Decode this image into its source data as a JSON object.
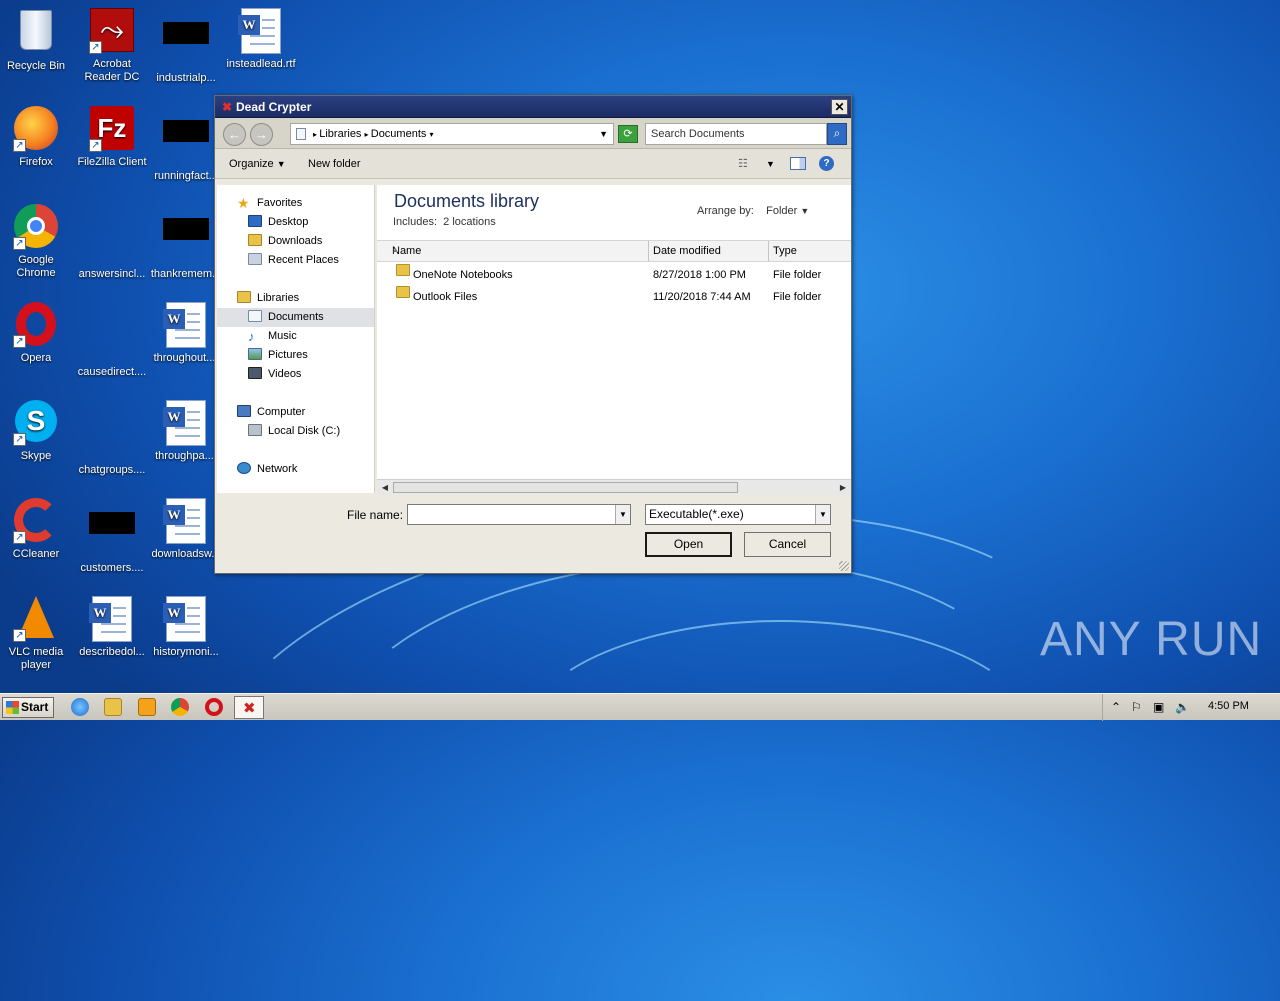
{
  "desktop": {
    "icons": [
      {
        "label": "Recycle Bin",
        "icon": "recycle-bin-icon"
      },
      {
        "label": "Acrobat Reader DC",
        "icon": "acrobat-icon"
      },
      {
        "label": "industrialp...",
        "icon": "redacted-icon"
      },
      {
        "label": "insteadlead.rtf",
        "icon": "word-doc-icon"
      },
      {
        "label": "Firefox",
        "icon": "firefox-icon"
      },
      {
        "label": "FileZilla Client",
        "icon": "filezilla-icon"
      },
      {
        "label": "runningfact...",
        "icon": "redacted-icon"
      },
      {
        "label": "Google Chrome",
        "icon": "chrome-icon"
      },
      {
        "label": "answersincl...",
        "icon": "blank-file-icon"
      },
      {
        "label": "thankremem...",
        "icon": "redacted-icon"
      },
      {
        "label": "Opera",
        "icon": "opera-icon"
      },
      {
        "label": "causedirect....",
        "icon": "blank-file-icon"
      },
      {
        "label": "throughout....",
        "icon": "word-doc-icon"
      },
      {
        "label": "Skype",
        "icon": "skype-icon"
      },
      {
        "label": "chatgroups....",
        "icon": "blank-file-icon"
      },
      {
        "label": "throughpa....",
        "icon": "word-doc-icon"
      },
      {
        "label": "CCleaner",
        "icon": "ccleaner-icon"
      },
      {
        "label": "customers....",
        "icon": "redacted-icon"
      },
      {
        "label": "downloadsw...",
        "icon": "word-doc-icon"
      },
      {
        "label": "VLC media player",
        "icon": "vlc-icon"
      },
      {
        "label": "describedol...",
        "icon": "word-doc-icon"
      },
      {
        "label": "historymoni...",
        "icon": "word-doc-icon"
      }
    ],
    "watermark": "ANY RUN"
  },
  "dialog": {
    "title": "Dead Crypter",
    "close": "✕",
    "breadcrumb": {
      "part1": "Libraries",
      "part2": "Documents"
    },
    "search_placeholder": "Search Documents",
    "toolbar": {
      "organize": "Organize",
      "new_folder": "New folder"
    },
    "nav": {
      "favorites": "Favorites",
      "desktop": "Desktop",
      "downloads": "Downloads",
      "recent": "Recent Places",
      "libraries": "Libraries",
      "documents": "Documents",
      "music": "Music",
      "pictures": "Pictures",
      "videos": "Videos",
      "computer": "Computer",
      "local_disk": "Local Disk (C:)",
      "network": "Network"
    },
    "library": {
      "title": "Documents library",
      "includes_label": "Includes:",
      "includes_value": "2 locations",
      "arrange_label": "Arrange by:",
      "arrange_value": "Folder"
    },
    "columns": {
      "name": "Name",
      "date": "Date modified",
      "type": "Type"
    },
    "files": [
      {
        "name": "OneNote Notebooks",
        "date": "8/27/2018 1:00 PM",
        "type": "File folder"
      },
      {
        "name": "Outlook Files",
        "date": "11/20/2018 7:44 AM",
        "type": "File folder"
      }
    ],
    "filename_label": "File name:",
    "filename_value": "",
    "filter": "Executable(*.exe)",
    "open_button": "Open",
    "cancel_button": "Cancel"
  },
  "taskbar": {
    "start": "Start",
    "clock": "4:50 PM"
  }
}
